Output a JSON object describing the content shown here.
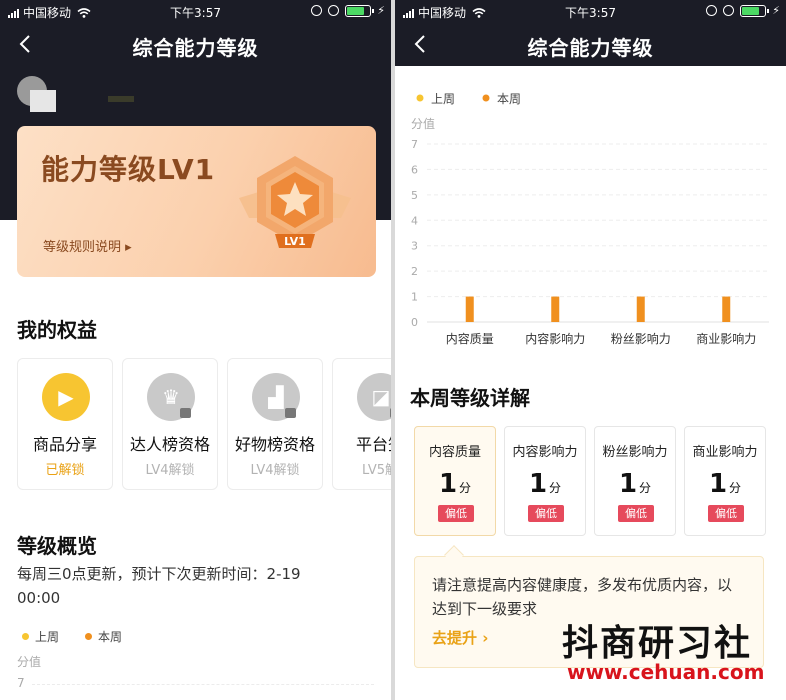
{
  "status_bar": {
    "carrier": "中国移动",
    "time": "下午3:57",
    "battery_color": "#4cd964"
  },
  "left": {
    "nav": {
      "title": "综合能力等级",
      "back_icon": "chevron-left-icon"
    },
    "level_card": {
      "title": "能力等级LV1",
      "rules_link": "等级规则说明 ▸",
      "badge_label": "LV1",
      "badge_icon": "star-hexagon-badge-icon"
    },
    "benefits": {
      "title": "我的权益",
      "items": [
        {
          "name": "商品分享",
          "status": "已解锁",
          "unlocked": true,
          "icon": "cart-play-icon"
        },
        {
          "name": "达人榜资格",
          "status": "LV4解锁",
          "unlocked": false,
          "icon": "trophy-icon"
        },
        {
          "name": "好物榜资格",
          "status": "LV4解锁",
          "unlocked": false,
          "icon": "podium-icon"
        },
        {
          "name": "平台签",
          "status": "LV5解",
          "unlocked": false,
          "icon": "seal-icon"
        }
      ]
    },
    "overview": {
      "title": "等级概览",
      "update_note": "每周三0点更新，预计下次更新时间：2-19 00:00",
      "legend": {
        "last_week": "上周",
        "this_week": "本周"
      },
      "y_axis_label": "分值",
      "first_tick": "7"
    }
  },
  "right": {
    "nav": {
      "title": "综合能力等级",
      "back_icon": "chevron-left-icon"
    },
    "chart_data": {
      "type": "bar",
      "categories": [
        "内容质量",
        "内容影响力",
        "粉丝影响力",
        "商业影响力"
      ],
      "series": [
        {
          "name": "上周",
          "values": [
            0,
            0,
            0,
            0
          ],
          "color": "#f7c531"
        },
        {
          "name": "本周",
          "values": [
            1,
            1,
            1,
            1
          ],
          "color": "#f0901f"
        }
      ],
      "ylabel": "分值",
      "ylim": [
        0,
        7
      ],
      "yticks": [
        "0",
        "1",
        "2",
        "3",
        "4",
        "5",
        "6",
        "7"
      ],
      "grid": true,
      "legend_position": "top-left"
    },
    "details": {
      "title": "本周等级详解",
      "unit": "分",
      "items": [
        {
          "name": "内容质量",
          "score": "1",
          "tag": "偏低",
          "active": true
        },
        {
          "name": "内容影响力",
          "score": "1",
          "tag": "偏低",
          "active": false
        },
        {
          "name": "粉丝影响力",
          "score": "1",
          "tag": "偏低",
          "active": false
        },
        {
          "name": "商业影响力",
          "score": "1",
          "tag": "偏低",
          "active": false
        }
      ],
      "tip_text": "请注意提高内容健康度，多发布优质内容，以达到下一级要求",
      "tip_link": "去提升 ›"
    },
    "watermark": {
      "text": "抖商研习社",
      "url": "www.cehuan.com"
    }
  }
}
